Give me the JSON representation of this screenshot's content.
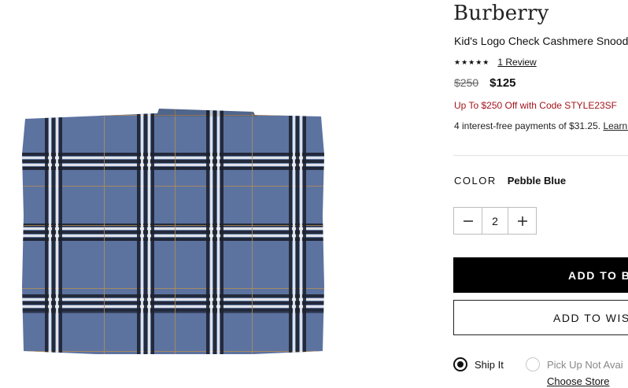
{
  "product": {
    "image_name": "Blue check cashmere snood",
    "brand": "Burberry",
    "title": "Kid's Logo Check Cashmere Snood",
    "rating": {
      "stars": "★★★★★",
      "stars_value": 5,
      "reviews_link": "1 Review"
    },
    "price": {
      "original": "$250",
      "sale": "$125"
    },
    "promo": "Up To $250 Off with Code STYLE23SF",
    "installments": {
      "text": "4 interest-free payments of $31.25. ",
      "link": "Learn m"
    },
    "color": {
      "label": "COLOR",
      "value": "Pebble Blue"
    },
    "quantity": {
      "value": "2",
      "decrement_icon": "minus-icon",
      "increment_icon": "plus-icon"
    },
    "buttons": {
      "add_to_bag": "ADD TO BA",
      "add_to_wishlist": "ADD TO WISH"
    },
    "fulfillment": {
      "ship_it": {
        "label": "Ship It",
        "selected": true
      },
      "pick_up": {
        "label": "Pick Up Not Avai",
        "selected": false
      },
      "choose_store": "Choose Store"
    }
  },
  "colors": {
    "accent": "#000000",
    "promo": "#a3141c",
    "plaid_base": "#5c73a0",
    "plaid_dark": "#1d2230",
    "plaid_white": "#eeeeee",
    "plaid_tan": "#b48c57"
  }
}
